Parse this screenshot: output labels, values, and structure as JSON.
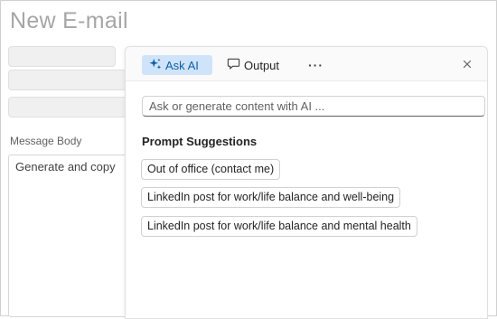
{
  "page": {
    "title": "New E-mail"
  },
  "form": {
    "message_body_label": "Message Body",
    "message_body_value": "Generate and copy"
  },
  "panel": {
    "tabs": {
      "ask_ai": "Ask AI",
      "output": "Output",
      "more": "···"
    },
    "search": {
      "placeholder": "Ask or generate content with AI ..."
    },
    "suggestions_title": "Prompt Suggestions",
    "suggestions": [
      "Out of office (contact me)",
      "LinkedIn post for work/life balance and well-being",
      "LinkedIn post for work/life balance and mental health"
    ]
  },
  "icons": {
    "ask_ai": "sparkle-icon",
    "output": "chat-bubble-icon",
    "close": "close-icon"
  },
  "colors": {
    "accent_bg": "#cfe4fa",
    "accent_text": "#115ea3"
  }
}
